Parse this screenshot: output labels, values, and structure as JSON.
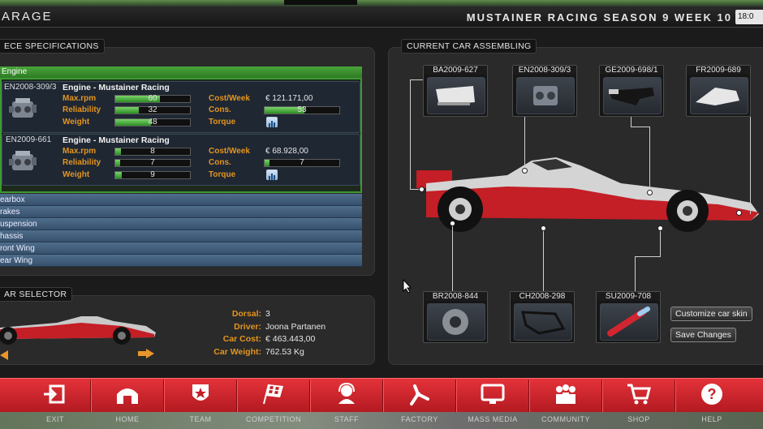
{
  "window": {
    "title": "ARAGE",
    "season": "MUSTAINER RACING SEASON 9 WEEK 10",
    "clock": "18:0"
  },
  "left_panel": {
    "title": "ECE SPECIFICATIONS",
    "section": "Engine",
    "engines": [
      {
        "code": "EN2008-309/3",
        "name": "Engine - Mustainer Racing",
        "maxrpm_label": "Max.rpm",
        "maxrpm": "60",
        "maxrpm_pct": 0.6,
        "reliability_label": "Reliability",
        "reliability": "32",
        "reliability_pct": 0.32,
        "weight_label": "Weight",
        "weight": "48",
        "weight_pct": 0.48,
        "costweek_label": "Cost/Week",
        "costweek": "€ 121.171,00",
        "cons_label": "Cons.",
        "cons": "53",
        "cons_pct": 0.53,
        "torque_label": "Torque"
      },
      {
        "code": "EN2009-661",
        "name": "Engine - Mustainer Racing",
        "maxrpm_label": "Max.rpm",
        "maxrpm": "8",
        "maxrpm_pct": 0.08,
        "reliability_label": "Reliability",
        "reliability": "7",
        "reliability_pct": 0.07,
        "weight_label": "Weight",
        "weight": "9",
        "weight_pct": 0.09,
        "costweek_label": "Cost/Week",
        "costweek": "€ 68.928,00",
        "cons_label": "Cons.",
        "cons": "7",
        "cons_pct": 0.07,
        "torque_label": "Torque"
      }
    ],
    "categories": [
      "earbox",
      "rakes",
      "uspension",
      "hassis",
      "ront Wing",
      "ear Wing"
    ]
  },
  "car_selector": {
    "title": "AR SELECTOR",
    "dorsal_label": "Dorsal:",
    "dorsal": "3",
    "driver_label": "Driver:",
    "driver": "Joona Partanen",
    "cost_label": "Car Cost:",
    "cost": "€ 463.443,00",
    "weight_label": "Car Weight:",
    "weight": "762.53 Kg"
  },
  "assembly": {
    "title": "CURRENT CAR ASSEMBLING",
    "top_parts": [
      "BA2009-627",
      "EN2008-309/3",
      "GE2009-698/1",
      "FR2009-689"
    ],
    "bottom_parts": [
      "BR2008-844",
      "CH2008-298",
      "SU2009-708"
    ],
    "customize_label": "Customize car skin",
    "save_label": "Save Changes"
  },
  "nav": [
    {
      "label": "EXIT",
      "icon": "exit-icon"
    },
    {
      "label": "HOME",
      "icon": "home-icon"
    },
    {
      "label": "TEAM",
      "icon": "team-icon"
    },
    {
      "label": "COMPETITION",
      "icon": "checkered-flag-icon"
    },
    {
      "label": "STAFF",
      "icon": "headset-icon"
    },
    {
      "label": "FACTORY",
      "icon": "robot-arm-icon"
    },
    {
      "label": "MASS MEDIA",
      "icon": "monitor-icon"
    },
    {
      "label": "COMMUNITY",
      "icon": "people-icon"
    },
    {
      "label": "SHOP",
      "icon": "cart-icon"
    },
    {
      "label": "HELP",
      "icon": "help-icon"
    }
  ],
  "colors": {
    "accent_red": "#d9262e",
    "label_orange": "#e3951f",
    "bar_green": "#4caf3a",
    "category_blue": "#46627f"
  }
}
